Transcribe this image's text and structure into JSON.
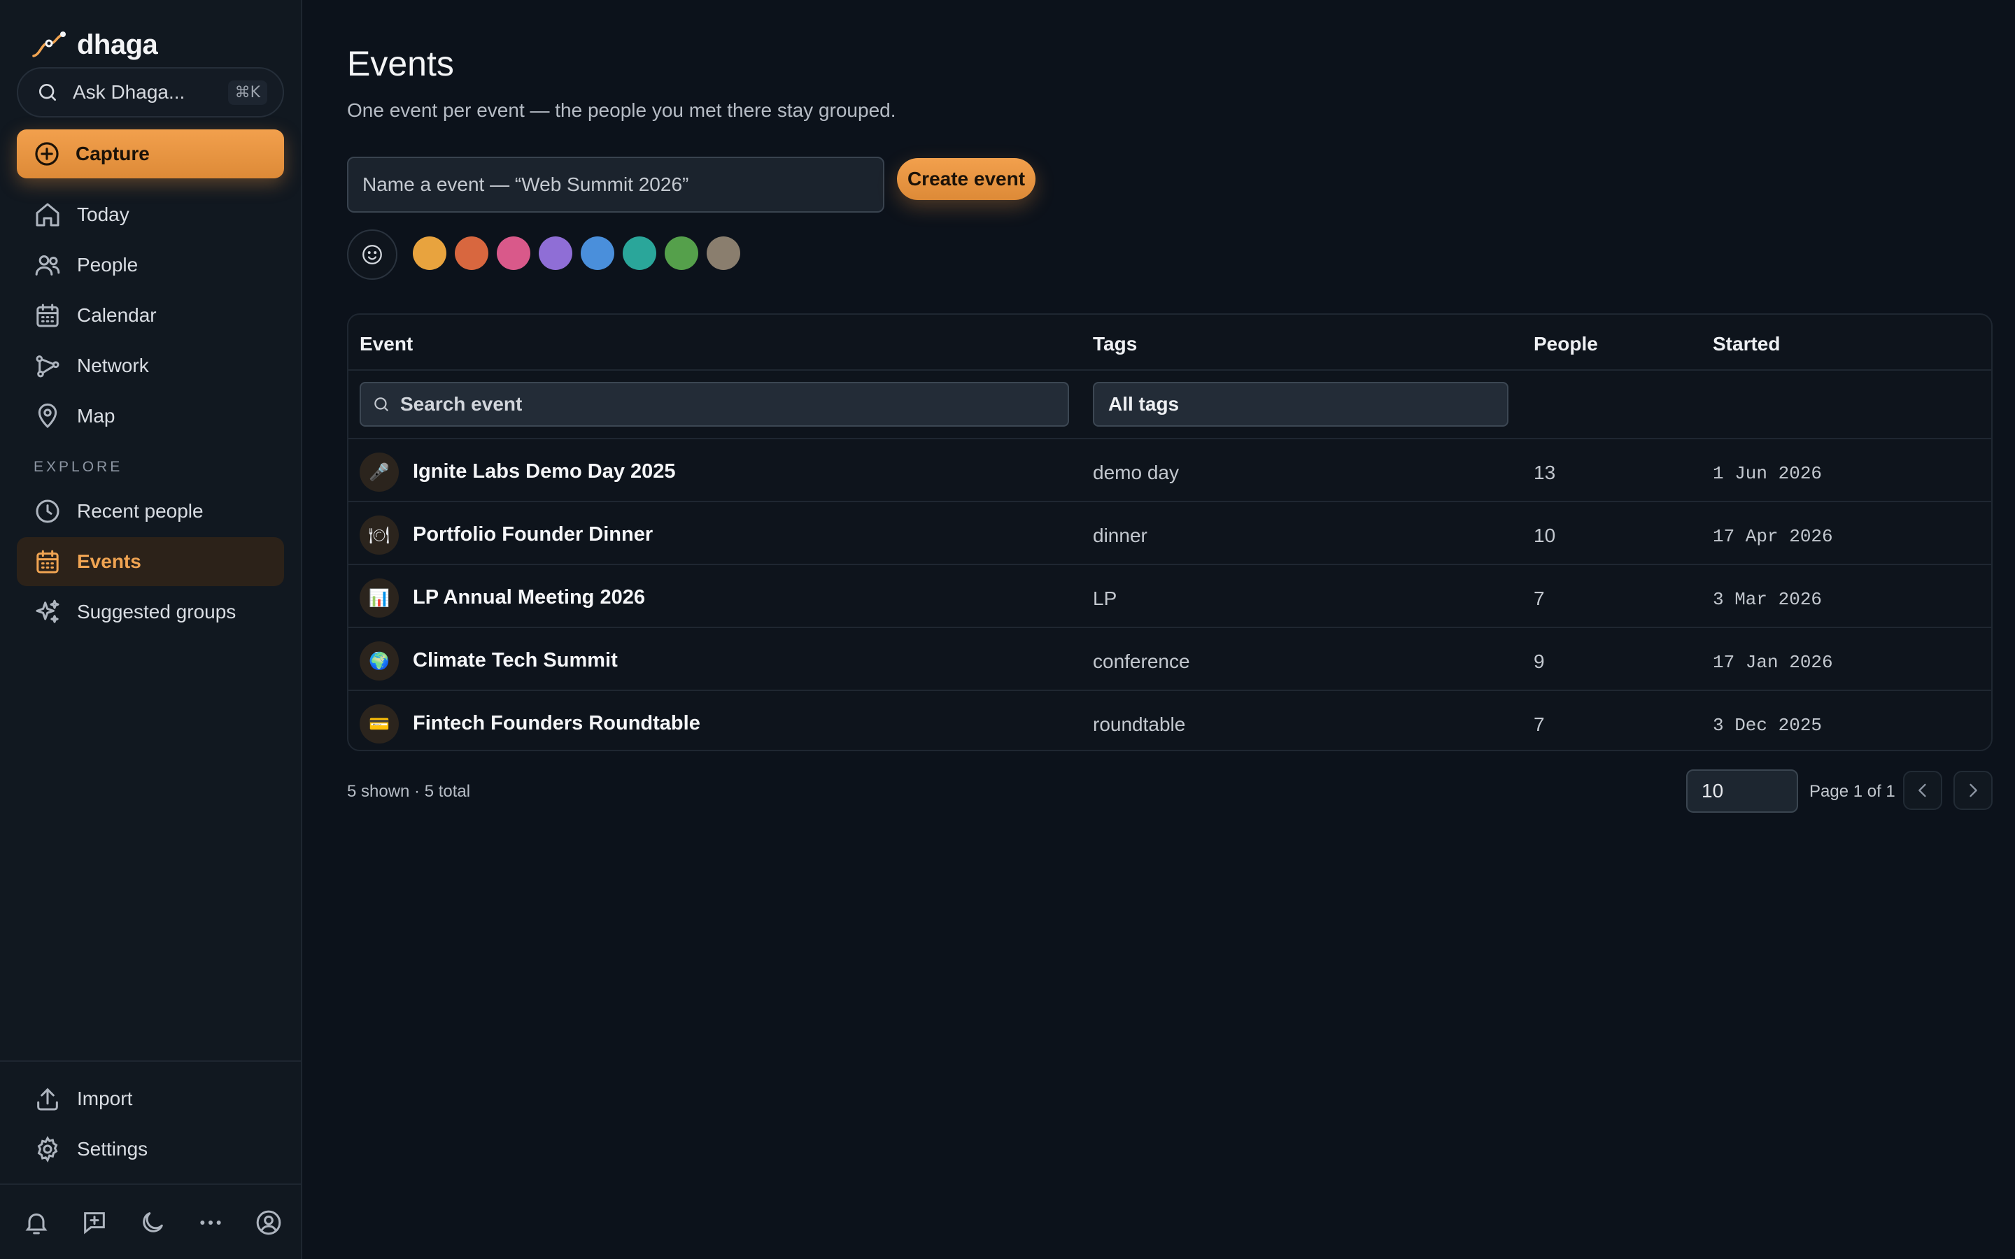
{
  "app": {
    "name": "dhaga"
  },
  "sidebar": {
    "ask_label": "Ask Dhaga...",
    "ask_shortcut": "⌘K",
    "capture_label": "Capture",
    "main_items": [
      {
        "label": "Today",
        "icon": "home-icon"
      },
      {
        "label": "People",
        "icon": "people-icon"
      },
      {
        "label": "Calendar",
        "icon": "calendar-icon"
      },
      {
        "label": "Network",
        "icon": "network-icon"
      },
      {
        "label": "Map",
        "icon": "map-pin-icon"
      }
    ],
    "explore_label": "EXPLORE",
    "explore_items": [
      {
        "label": "Recent people",
        "icon": "clock-icon"
      },
      {
        "label": "Events",
        "icon": "calendar-icon",
        "active": true
      },
      {
        "label": "Suggested groups",
        "icon": "sparkles-icon"
      }
    ],
    "bottom_items": [
      {
        "label": "Import",
        "icon": "upload-icon"
      },
      {
        "label": "Settings",
        "icon": "gear-icon"
      }
    ],
    "footer_icons": [
      "bell-icon",
      "new-message-icon",
      "moon-icon",
      "more-icon",
      "account-icon"
    ]
  },
  "main": {
    "title": "Events",
    "subtitle": "One event per event — the people you met there stay grouped.",
    "name_placeholder": "Name a event — “Web Summit 2026”",
    "create_label": "Create event",
    "colors": [
      "#e8a33e",
      "#d8673f",
      "#d9598a",
      "#8f6ed6",
      "#4a8fdb",
      "#2aa69a",
      "#55a04b",
      "#8a7e6e"
    ],
    "accent": "#f0a452"
  },
  "table": {
    "columns": [
      "Event",
      "Tags",
      "People",
      "Started"
    ],
    "search_placeholder": "Search event",
    "tags_filter": "All tags",
    "rows": [
      {
        "emoji": "🎤",
        "name": "Ignite Labs Demo Day 2025",
        "tag": "demo day",
        "people": "13",
        "started": "1 Jun 2026"
      },
      {
        "emoji": "🍽",
        "name": "Portfolio Founder Dinner",
        "tag": "dinner",
        "people": "10",
        "started": "17 Apr 2026"
      },
      {
        "emoji": "📊",
        "name": "LP Annual Meeting 2026",
        "tag": "LP",
        "people": "7",
        "started": "3 Mar 2026"
      },
      {
        "emoji": "🌍",
        "name": "Climate Tech Summit",
        "tag": "conference",
        "people": "9",
        "started": "17 Jan 2026"
      },
      {
        "emoji": "💳",
        "name": "Fintech Founders Roundtable",
        "tag": "roundtable",
        "people": "7",
        "started": "3 Dec 2025"
      }
    ]
  },
  "footer": {
    "count": "5 shown · 5 total",
    "page_size": "10",
    "page_info": "Page 1 of 1"
  }
}
